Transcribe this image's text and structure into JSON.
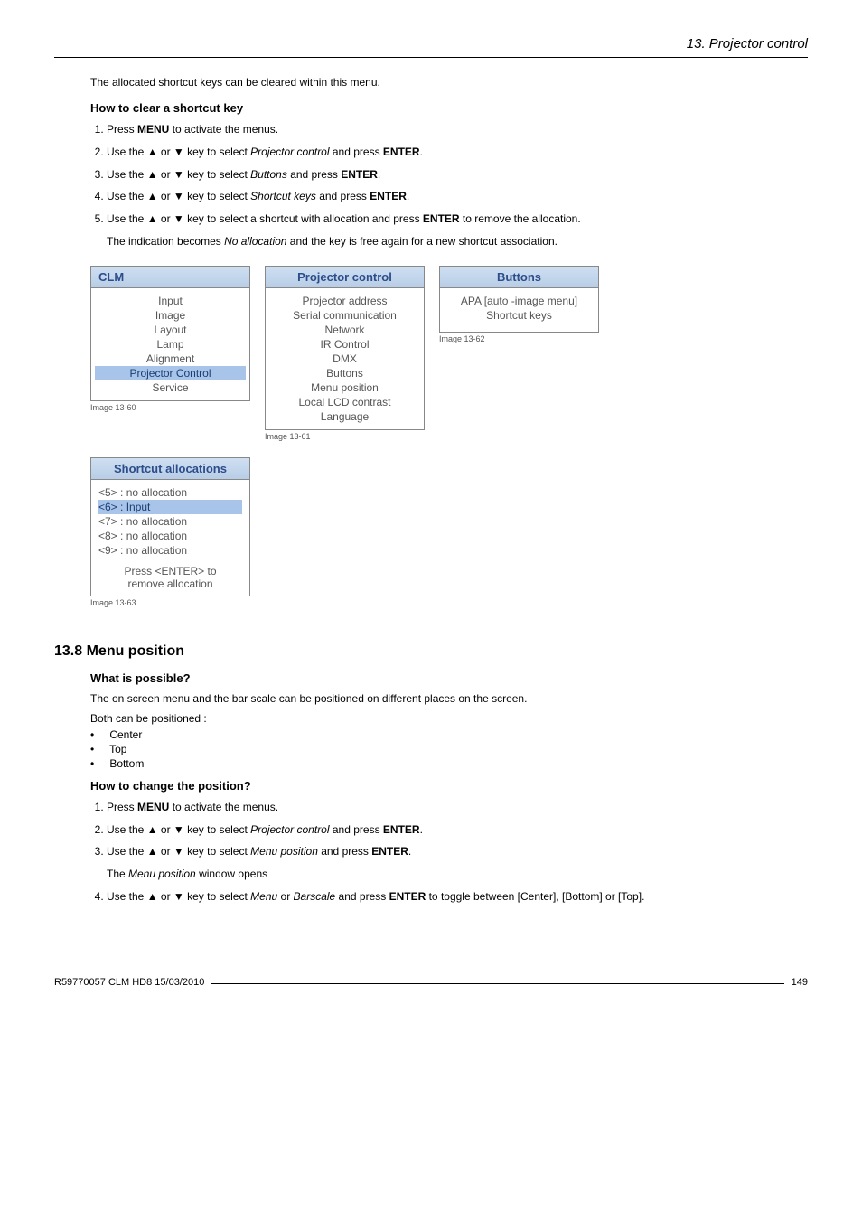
{
  "header": {
    "chapter": "13.  Projector control"
  },
  "intro": "The allocated shortcut keys can be cleared within this menu.",
  "howClear": {
    "heading": "How to clear a shortcut key",
    "step1_a": "Press ",
    "step1_bold": "MENU",
    "step1_b": " to activate the menus.",
    "step2_a": "Use the ▲ or ▼ key to select ",
    "step2_i": "Projector control",
    "step2_b": " and press ",
    "step2_bold": "ENTER",
    "step2_c": ".",
    "step3_a": "Use the ▲ or ▼ key to select ",
    "step3_i": "Buttons",
    "step3_b": " and press ",
    "step3_bold": "ENTER",
    "step3_c": ".",
    "step4_a": "Use the ▲ or ▼ key to select ",
    "step4_i": "Shortcut keys",
    "step4_b": " and press ",
    "step4_bold": "ENTER",
    "step4_c": ".",
    "step5_a": "Use the ▲ or ▼ key to select a shortcut with allocation and press ",
    "step5_bold": "ENTER",
    "step5_b": " to remove the allocation.",
    "step5_sub_a": "The indication becomes ",
    "step5_sub_i": "No allocation",
    "step5_sub_b": " and the key is free again for a new shortcut association."
  },
  "menu1": {
    "title": "CLM",
    "items": [
      "Input",
      "Image",
      "Layout",
      "Lamp",
      "Alignment",
      "Projector Control",
      "Service"
    ],
    "highlightIndex": 5,
    "caption": "Image 13-60"
  },
  "menu2": {
    "title": "Projector control",
    "items": [
      "Projector address",
      "Serial communication",
      "Network",
      "IR Control",
      "DMX",
      "Buttons",
      "Menu position",
      "Local LCD contrast",
      "Language"
    ],
    "caption": "Image 13-61"
  },
  "menu3": {
    "title": "Buttons",
    "items": [
      "APA [auto -image menu]",
      "Shortcut keys"
    ],
    "caption": "Image 13-62"
  },
  "menu4": {
    "title": "Shortcut allocations",
    "rows": [
      {
        "k": "<5>",
        "v": "no allocation"
      },
      {
        "k": "<6>",
        "v": "Input",
        "hl": true
      },
      {
        "k": "<7>",
        "v": "no allocation"
      },
      {
        "k": "<8>",
        "v": "no allocation"
      },
      {
        "k": "<9>",
        "v": "no allocation"
      }
    ],
    "footer1": "Press <ENTER> to",
    "footer2": "remove allocation",
    "caption": "Image 13-63"
  },
  "section": {
    "heading": "13.8  Menu position",
    "q1heading": "What is possible?",
    "q1text": "The on screen menu and the bar scale can be positioned on different places on the screen.",
    "q1text2": "Both can be positioned :",
    "bullets": [
      "Center",
      "Top",
      "Bottom"
    ],
    "q2heading": "How to change the position?",
    "s1_a": "Press ",
    "s1_bold": "MENU",
    "s1_b": " to activate the menus.",
    "s2_a": "Use the ▲ or ▼ key to select ",
    "s2_i": "Projector control",
    "s2_b": " and press ",
    "s2_bold": "ENTER",
    "s2_c": ".",
    "s3_a": "Use the ▲ or ▼ key to select ",
    "s3_i": "Menu position",
    "s3_b": " and press ",
    "s3_bold": "ENTER",
    "s3_c": ".",
    "s3_sub_a": "The ",
    "s3_sub_i": "Menu position",
    "s3_sub_b": " window opens",
    "s4_a": "Use the ▲ or ▼ key to select ",
    "s4_i1": "Menu",
    "s4_b": " or ",
    "s4_i2": "Barscale",
    "s4_c": " and press ",
    "s4_bold": "ENTER",
    "s4_d": " to toggle between [Center], [Bottom] or [Top]."
  },
  "footer": {
    "left": "R59770057  CLM HD8  15/03/2010",
    "page": "149"
  }
}
